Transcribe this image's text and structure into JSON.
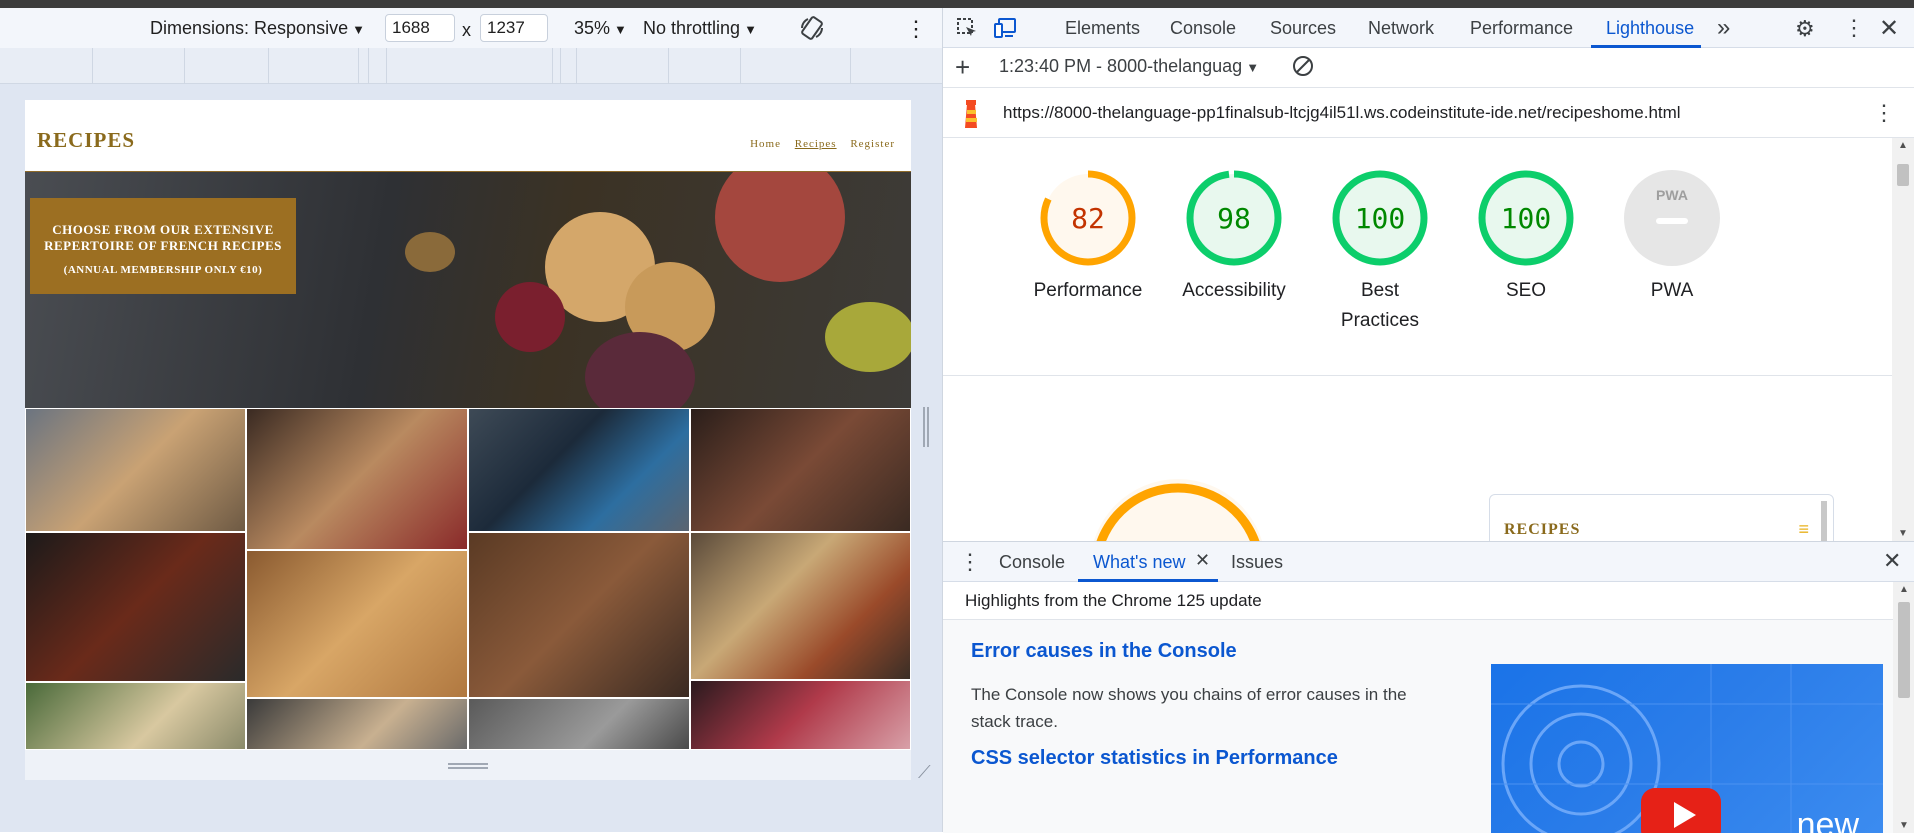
{
  "device_toolbar": {
    "dimensions_label": "Dimensions: Responsive",
    "width": "1688",
    "times": "x",
    "height": "1237",
    "zoom": "35%",
    "throttling": "No throttling"
  },
  "site": {
    "logo": "RECIPES",
    "nav": [
      "Home",
      "Recipes",
      "Register"
    ],
    "hero_line1": "CHOOSE FROM OUR EXTENSIVE",
    "hero_line2": "REPERTOIRE OF FRENCH RECIPES",
    "hero_sub": "(ANNUAL MEMBERSHIP ONLY €10)"
  },
  "devtools": {
    "tabs": [
      "Elements",
      "Console",
      "Sources",
      "Network",
      "Performance",
      "Lighthouse"
    ],
    "more_tabs": "»",
    "report_label": "1:23:40 PM - 8000-thelanguag",
    "url": "https://8000-thelanguage-pp1finalsub-ltcjg4il51l.ws.codeinstitute-ide.net/recipeshome.html",
    "scores": [
      {
        "label": "Performance",
        "value": "82",
        "score": 82,
        "color": "#ffa400",
        "text_color": "#c33300",
        "bg": "#fff8ee"
      },
      {
        "label": "Accessibility",
        "value": "98",
        "score": 98,
        "color": "#0cce6b",
        "text_color": "#008800",
        "bg": "#e8f8ee"
      },
      {
        "label": "Best Practices",
        "value": "100",
        "score": 100,
        "color": "#0cce6b",
        "text_color": "#008800",
        "bg": "#e8f8ee"
      },
      {
        "label": "SEO",
        "value": "100",
        "score": 100,
        "color": "#0cce6b",
        "text_color": "#008800",
        "bg": "#e8f8ee"
      },
      {
        "label": "PWA",
        "value": "PWA",
        "score": 0,
        "color": "#e0e0e0",
        "text_color": "#9e9e9e",
        "bg": "#e6e6e6"
      }
    ],
    "thumb_logo": "RECIPES",
    "drawer_tabs": [
      "Console",
      "What's new",
      "Issues"
    ],
    "highlights": "Highlights from the Chrome 125 update",
    "whatsnew_items": [
      {
        "title": "Error causes in the Console",
        "body": "The Console now shows you chains of error causes in the stack trace."
      },
      {
        "title": "CSS selector statistics in Performance",
        "body": ""
      }
    ],
    "video_badge": "new"
  },
  "colors": {
    "brand_gold": "#8a6a1c",
    "hero_box": "#9c6f22",
    "devtools_blue": "#0b57d0"
  }
}
